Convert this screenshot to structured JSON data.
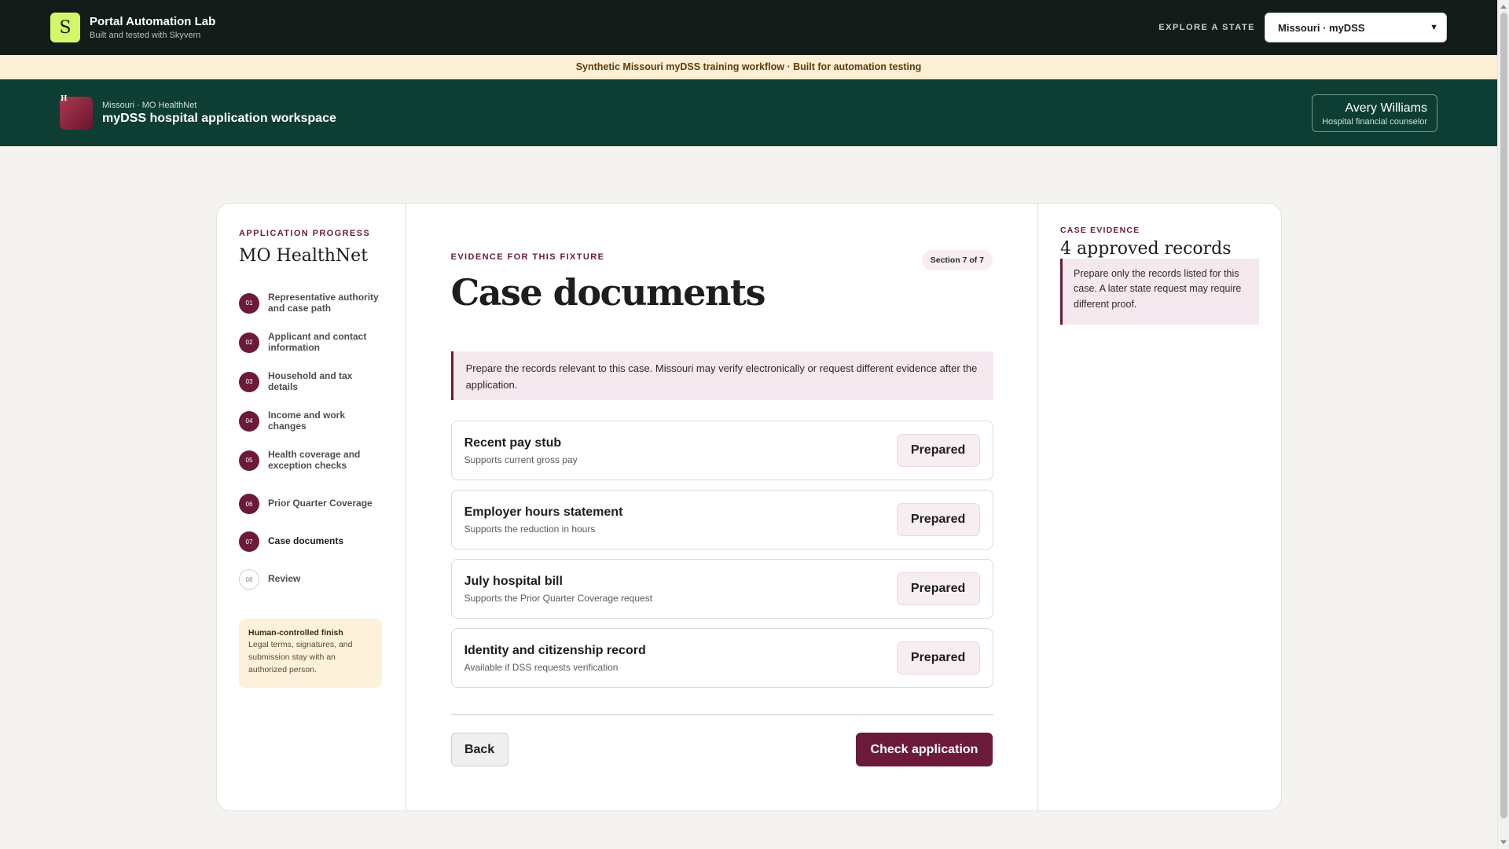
{
  "topbar": {
    "logo_letter": "S",
    "title": "Portal Automation Lab",
    "subtitle": "Built and tested with Skyvern",
    "explore_label": "EXPLORE A STATE",
    "state_selected": "Missouri · myDSS"
  },
  "notice": "Synthetic Missouri myDSS training workflow · Built for automation testing",
  "agency": {
    "logo_letter": "H",
    "sub": "Missouri · MO HealthNet",
    "title": "myDSS hospital application workspace",
    "user_name": "Avery Williams",
    "user_role": "Hospital financial counselor"
  },
  "sidebar": {
    "eyebrow": "APPLICATION PROGRESS",
    "title": "MO HealthNet",
    "steps": [
      {
        "num": "01",
        "label": "Representative authority and case path"
      },
      {
        "num": "02",
        "label": "Applicant and contact information"
      },
      {
        "num": "03",
        "label": "Household and tax details"
      },
      {
        "num": "04",
        "label": "Income and work changes"
      },
      {
        "num": "05",
        "label": "Health coverage and exception checks"
      },
      {
        "num": "06",
        "label": "Prior Quarter Coverage"
      },
      {
        "num": "07",
        "label": "Case documents"
      },
      {
        "num": "08",
        "label": "Review"
      }
    ],
    "finish_title": "Human-controlled finish",
    "finish_body": "Legal terms, signatures, and submission stay with an authorized person."
  },
  "main": {
    "eyebrow": "EVIDENCE FOR THIS FIXTURE",
    "section": "Section 7 of 7",
    "title": "Case documents",
    "notice": "Prepare the records relevant to this case. Missouri may verify electronically or request different evidence after the application.",
    "documents": [
      {
        "name": "Recent pay stub",
        "desc": "Supports current gross pay",
        "status": "Prepared"
      },
      {
        "name": "Employer hours statement",
        "desc": "Supports the reduction in hours",
        "status": "Prepared"
      },
      {
        "name": "July hospital bill",
        "desc": "Supports the Prior Quarter Coverage request",
        "status": "Prepared"
      },
      {
        "name": "Identity and citizenship record",
        "desc": "Available if DSS requests verification",
        "status": "Prepared"
      }
    ],
    "back_label": "Back",
    "check_label": "Check application"
  },
  "aside": {
    "eyebrow": "CASE EVIDENCE",
    "title": "4 approved records",
    "note": "Prepare only the records listed for this case. A later state request may require different proof."
  }
}
